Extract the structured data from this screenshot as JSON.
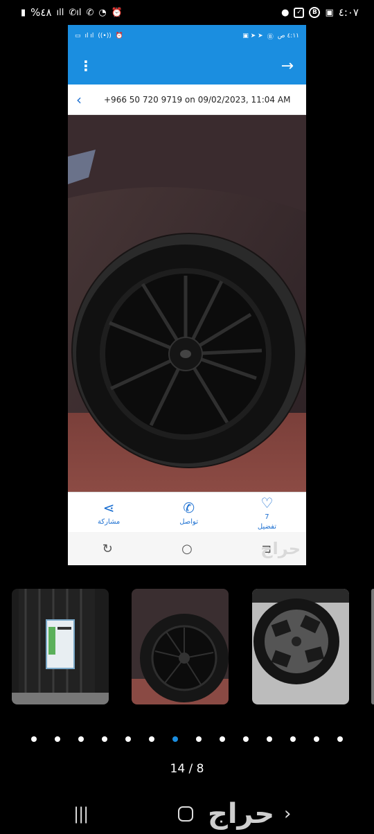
{
  "status_bar": {
    "time": "٤:٠٧",
    "battery": "%٤٨"
  },
  "embedded": {
    "status_time": "٤:١١ ص",
    "message_header": "+966 50 720 9719 on 09/02/2023, 11:04 AM",
    "actions": [
      {
        "label": "مشاركة",
        "icon": "share-icon"
      },
      {
        "label": "تواصل",
        "icon": "phone-icon"
      },
      {
        "label": "تفضيل",
        "icon": "heart-icon",
        "count": "7"
      }
    ],
    "watermark": "حراج"
  },
  "gallery": {
    "counter": "14 / 8",
    "total_dots": 14,
    "active_dot": 7
  },
  "watermark": "حراج",
  "colors": {
    "accent": "#1b8ee0"
  }
}
